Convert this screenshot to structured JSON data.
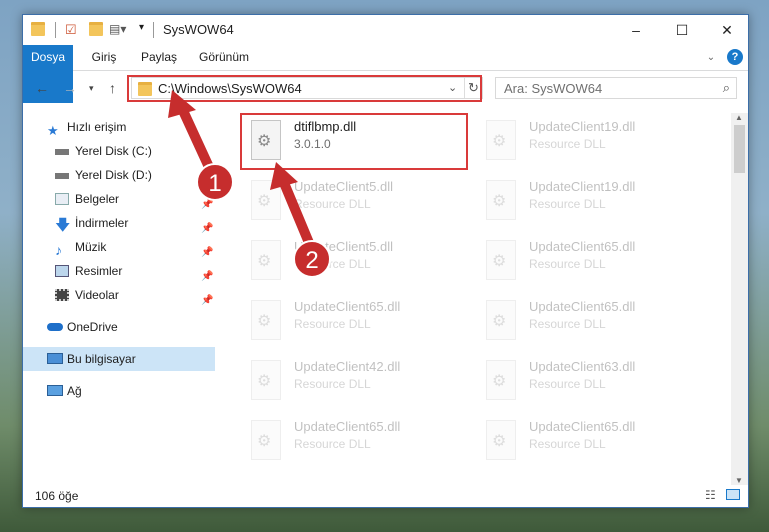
{
  "window": {
    "title": "SysWOW64"
  },
  "ribbon": {
    "tabs": [
      "Dosya",
      "Giriş",
      "Paylaş",
      "Görünüm"
    ]
  },
  "address": {
    "path": "C:\\Windows\\SysWOW64",
    "search_placeholder": "Ara: SysWOW64"
  },
  "sidebar": {
    "items": [
      {
        "label": "Hızlı erişim",
        "icon": "star-icon"
      },
      {
        "label": "Yerel Disk (C:)",
        "icon": "drive-icon"
      },
      {
        "label": "Yerel Disk (D:)",
        "icon": "drive-icon"
      },
      {
        "label": "Belgeler",
        "icon": "documents-icon"
      },
      {
        "label": "İndirmeler",
        "icon": "download-icon"
      },
      {
        "label": "Müzik",
        "icon": "music-icon"
      },
      {
        "label": "Resimler",
        "icon": "pictures-icon"
      },
      {
        "label": "Videolar",
        "icon": "videos-icon"
      },
      {
        "label": "OneDrive",
        "icon": "cloud-icon"
      },
      {
        "label": "Bu bilgisayar",
        "icon": "computer-icon"
      },
      {
        "label": "Ağ",
        "icon": "network-icon"
      }
    ]
  },
  "files": [
    {
      "name": "dtiflbmp.dll",
      "desc": "3.0.1.0"
    },
    {
      "name": "UpdateClient19.dll",
      "desc": "Resource DLL"
    },
    {
      "name": "UpdateClient5.dll",
      "desc": "Resource DLL"
    },
    {
      "name": "UpdateClient19.dll",
      "desc": "Resource DLL"
    },
    {
      "name": "UpdateClient5.dll",
      "desc": "Resource DLL"
    },
    {
      "name": "UpdateClient65.dll",
      "desc": "Resource DLL"
    },
    {
      "name": "UpdateClient65.dll",
      "desc": "Resource DLL"
    },
    {
      "name": "UpdateClient65.dll",
      "desc": "Resource DLL"
    },
    {
      "name": "UpdateClient42.dll",
      "desc": "Resource DLL"
    },
    {
      "name": "UpdateClient63.dll",
      "desc": "Resource DLL"
    },
    {
      "name": "UpdateClient65.dll",
      "desc": "Resource DLL"
    },
    {
      "name": "UpdateClient65.dll",
      "desc": "Resource DLL"
    }
  ],
  "status": {
    "count": "106 öğe"
  },
  "callouts": [
    "1",
    "2"
  ],
  "colors": {
    "accent": "#1979ca",
    "highlight": "#d93a3a",
    "callout": "#c62d2d"
  }
}
